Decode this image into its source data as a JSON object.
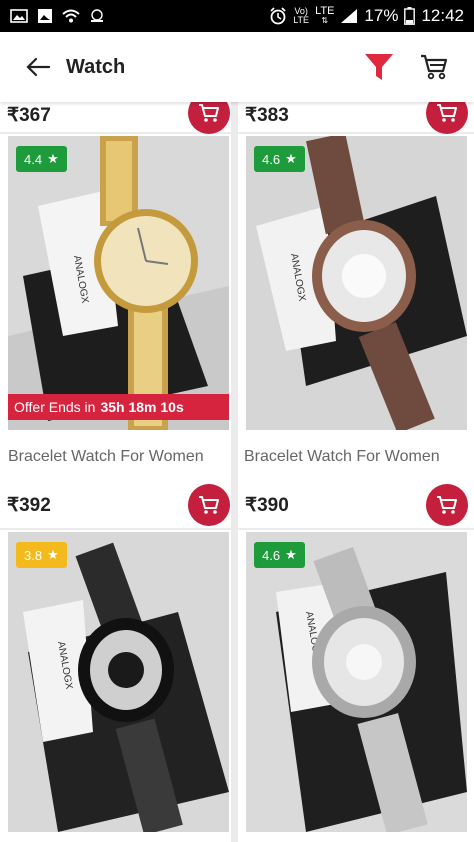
{
  "status_bar": {
    "volte": "Vo)",
    "lte_small": "LTE",
    "lte": "LTE",
    "battery": "17%",
    "time": "12:42"
  },
  "header": {
    "title": "Watch",
    "icons": [
      "back-arrow-icon",
      "filter-icon",
      "cart-icon"
    ],
    "accent": "#e0283f"
  },
  "products": [
    {
      "price": "₹367"
    },
    {
      "price": "₹383"
    },
    {
      "rating": "4.4",
      "rating_color": "#1e9b3b",
      "offer_label": "Offer Ends in",
      "offer_time": "35h 18m 10s",
      "name": "Bracelet Watch For Women",
      "price": "₹392",
      "watch": "gold"
    },
    {
      "rating": "4.6",
      "rating_color": "#1e9b3b",
      "name": "Bracelet Watch For Women",
      "price": "₹390",
      "watch": "rose"
    },
    {
      "rating": "3.8",
      "rating_color": "#f4b91c",
      "watch": "black"
    },
    {
      "rating": "4.6",
      "rating_color": "#1e9b3b",
      "watch": "silver"
    }
  ],
  "brand_tag": "ANALOGX",
  "cart_button_color": "#c4203d"
}
